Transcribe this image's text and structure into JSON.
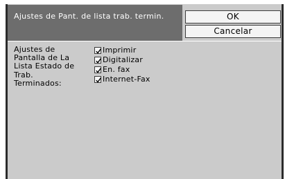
{
  "dialog": {
    "title": "Ajustes de Pant. de lista trab. termin.",
    "ok_label": "OK",
    "cancel_label": "Cancelar"
  },
  "setting": {
    "label_lines": [
      "Ajustes de",
      "Pantalla de La",
      "Lista Estado de",
      "Trab.",
      "Terminados:"
    ],
    "options": [
      {
        "label": "Imprimir",
        "checked": true
      },
      {
        "label": "Digitalizar",
        "checked": true
      },
      {
        "label": "En. fax",
        "checked": true
      },
      {
        "label": "Internet-Fax",
        "checked": true
      }
    ]
  },
  "colors": {
    "panel_bg": "#cbcbcb",
    "title_bg": "#6d6d6d",
    "frame": "#2b2b2b",
    "button_bg": "#f4f4f4"
  }
}
